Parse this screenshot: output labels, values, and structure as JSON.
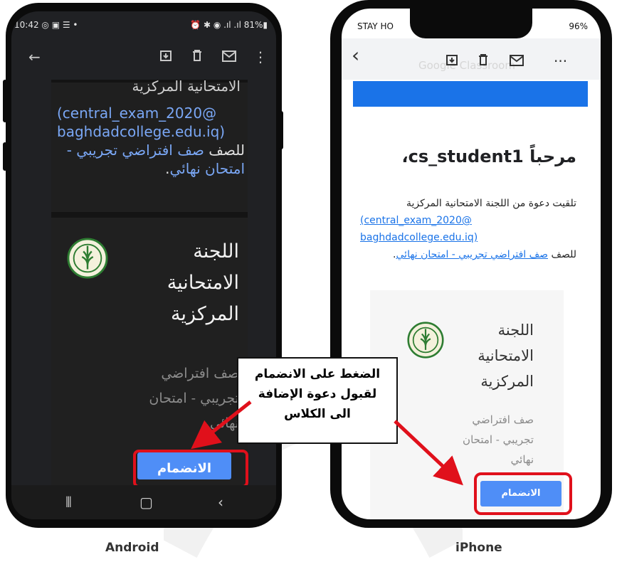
{
  "android": {
    "status_time": "10:42",
    "status_icons": "◎ ▣ ☰ •",
    "status_right": "⏰ ✱ ◉ .ıl .ıl 81%▮",
    "cut_text": "الامتحانية المركزية",
    "email_link": "(central_exam_2020@\nbaghdadcollege.edu.iq)",
    "class_prefix": "للصف ",
    "class_link": "صف افتراضي تجريبي - امتحان نهائي",
    "period": ".",
    "org_name": "اللجنة الامتحانية المركزية",
    "class_name": "صف افتراضي تجريبي - امتحان نهائي",
    "join_label": "الانضمام",
    "caption": "Android"
  },
  "iphone": {
    "status_left": "STAY HO",
    "status_right": "96%",
    "ghost_title": "Google Classroom",
    "greeting": "مرحباً cs_student1،",
    "invite_intro": "تلقيت دعوة من اللجنة الامتحانية المركزية",
    "email_link": "(central_exam_2020@\nbaghdadcollege.edu.iq)",
    "class_prefix": "للصف",
    "class_link": "صف افتراضي تجريبي - امتحان نهائي",
    "period": ".",
    "org_name": "اللجنة الامتحانية المركزية",
    "class_name": "صف افتراضي تجريبي - امتحان نهائي",
    "join_label": "الانضمام",
    "caption": "iPhone"
  },
  "callout": {
    "line1": "الضغط على الانضمام",
    "line2": "لقبول دعوة الإضافة",
    "line3": "الى الكلاس"
  },
  "colors": {
    "android_bg": "#202124",
    "android_link": "#7aa7f5",
    "join_button": "#4f8ef7",
    "highlight_ring": "#e0101b",
    "iphone_banner": "#1a73e8"
  },
  "icons": [
    "back-arrow-icon",
    "archive-icon",
    "trash-icon",
    "mail-icon",
    "more-vert-icon",
    "more-horiz-icon",
    "chevron-left-icon",
    "recents-icon",
    "home-icon"
  ]
}
